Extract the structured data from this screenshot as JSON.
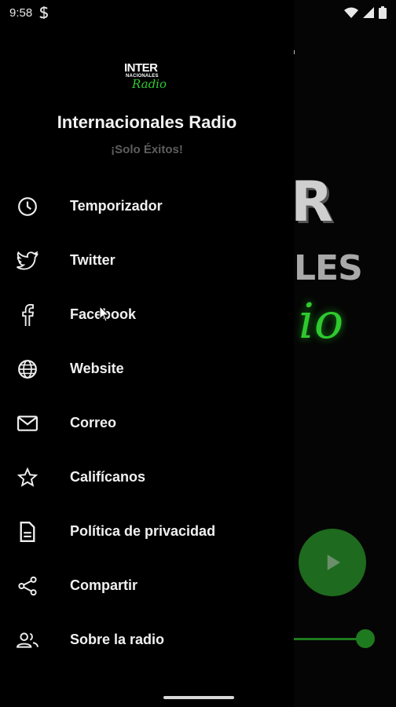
{
  "status": {
    "time": "9:58"
  },
  "drawer": {
    "logo_line1": "INTER",
    "logo_line2": "NACIONALES",
    "logo_line3": "Radio",
    "title": "Internacionales Radio",
    "subtitle": "¡Solo Éxitos!"
  },
  "menu": [
    {
      "label": "Temporizador",
      "icon": "clock-icon"
    },
    {
      "label": "Twitter",
      "icon": "twitter-icon"
    },
    {
      "label": "Facebook",
      "icon": "facebook-icon"
    },
    {
      "label": "Website",
      "icon": "globe-icon"
    },
    {
      "label": "Correo",
      "icon": "mail-icon"
    },
    {
      "label": "Califícanos",
      "icon": "star-icon"
    },
    {
      "label": "Política de privacidad",
      "icon": "document-icon"
    },
    {
      "label": "Compartir",
      "icon": "share-icon"
    },
    {
      "label": "Sobre la radio",
      "icon": "people-icon"
    }
  ],
  "player": {
    "volume_percent": 100
  },
  "colors": {
    "accent": "#1e7a1e",
    "logo_green": "#2ec92e"
  }
}
